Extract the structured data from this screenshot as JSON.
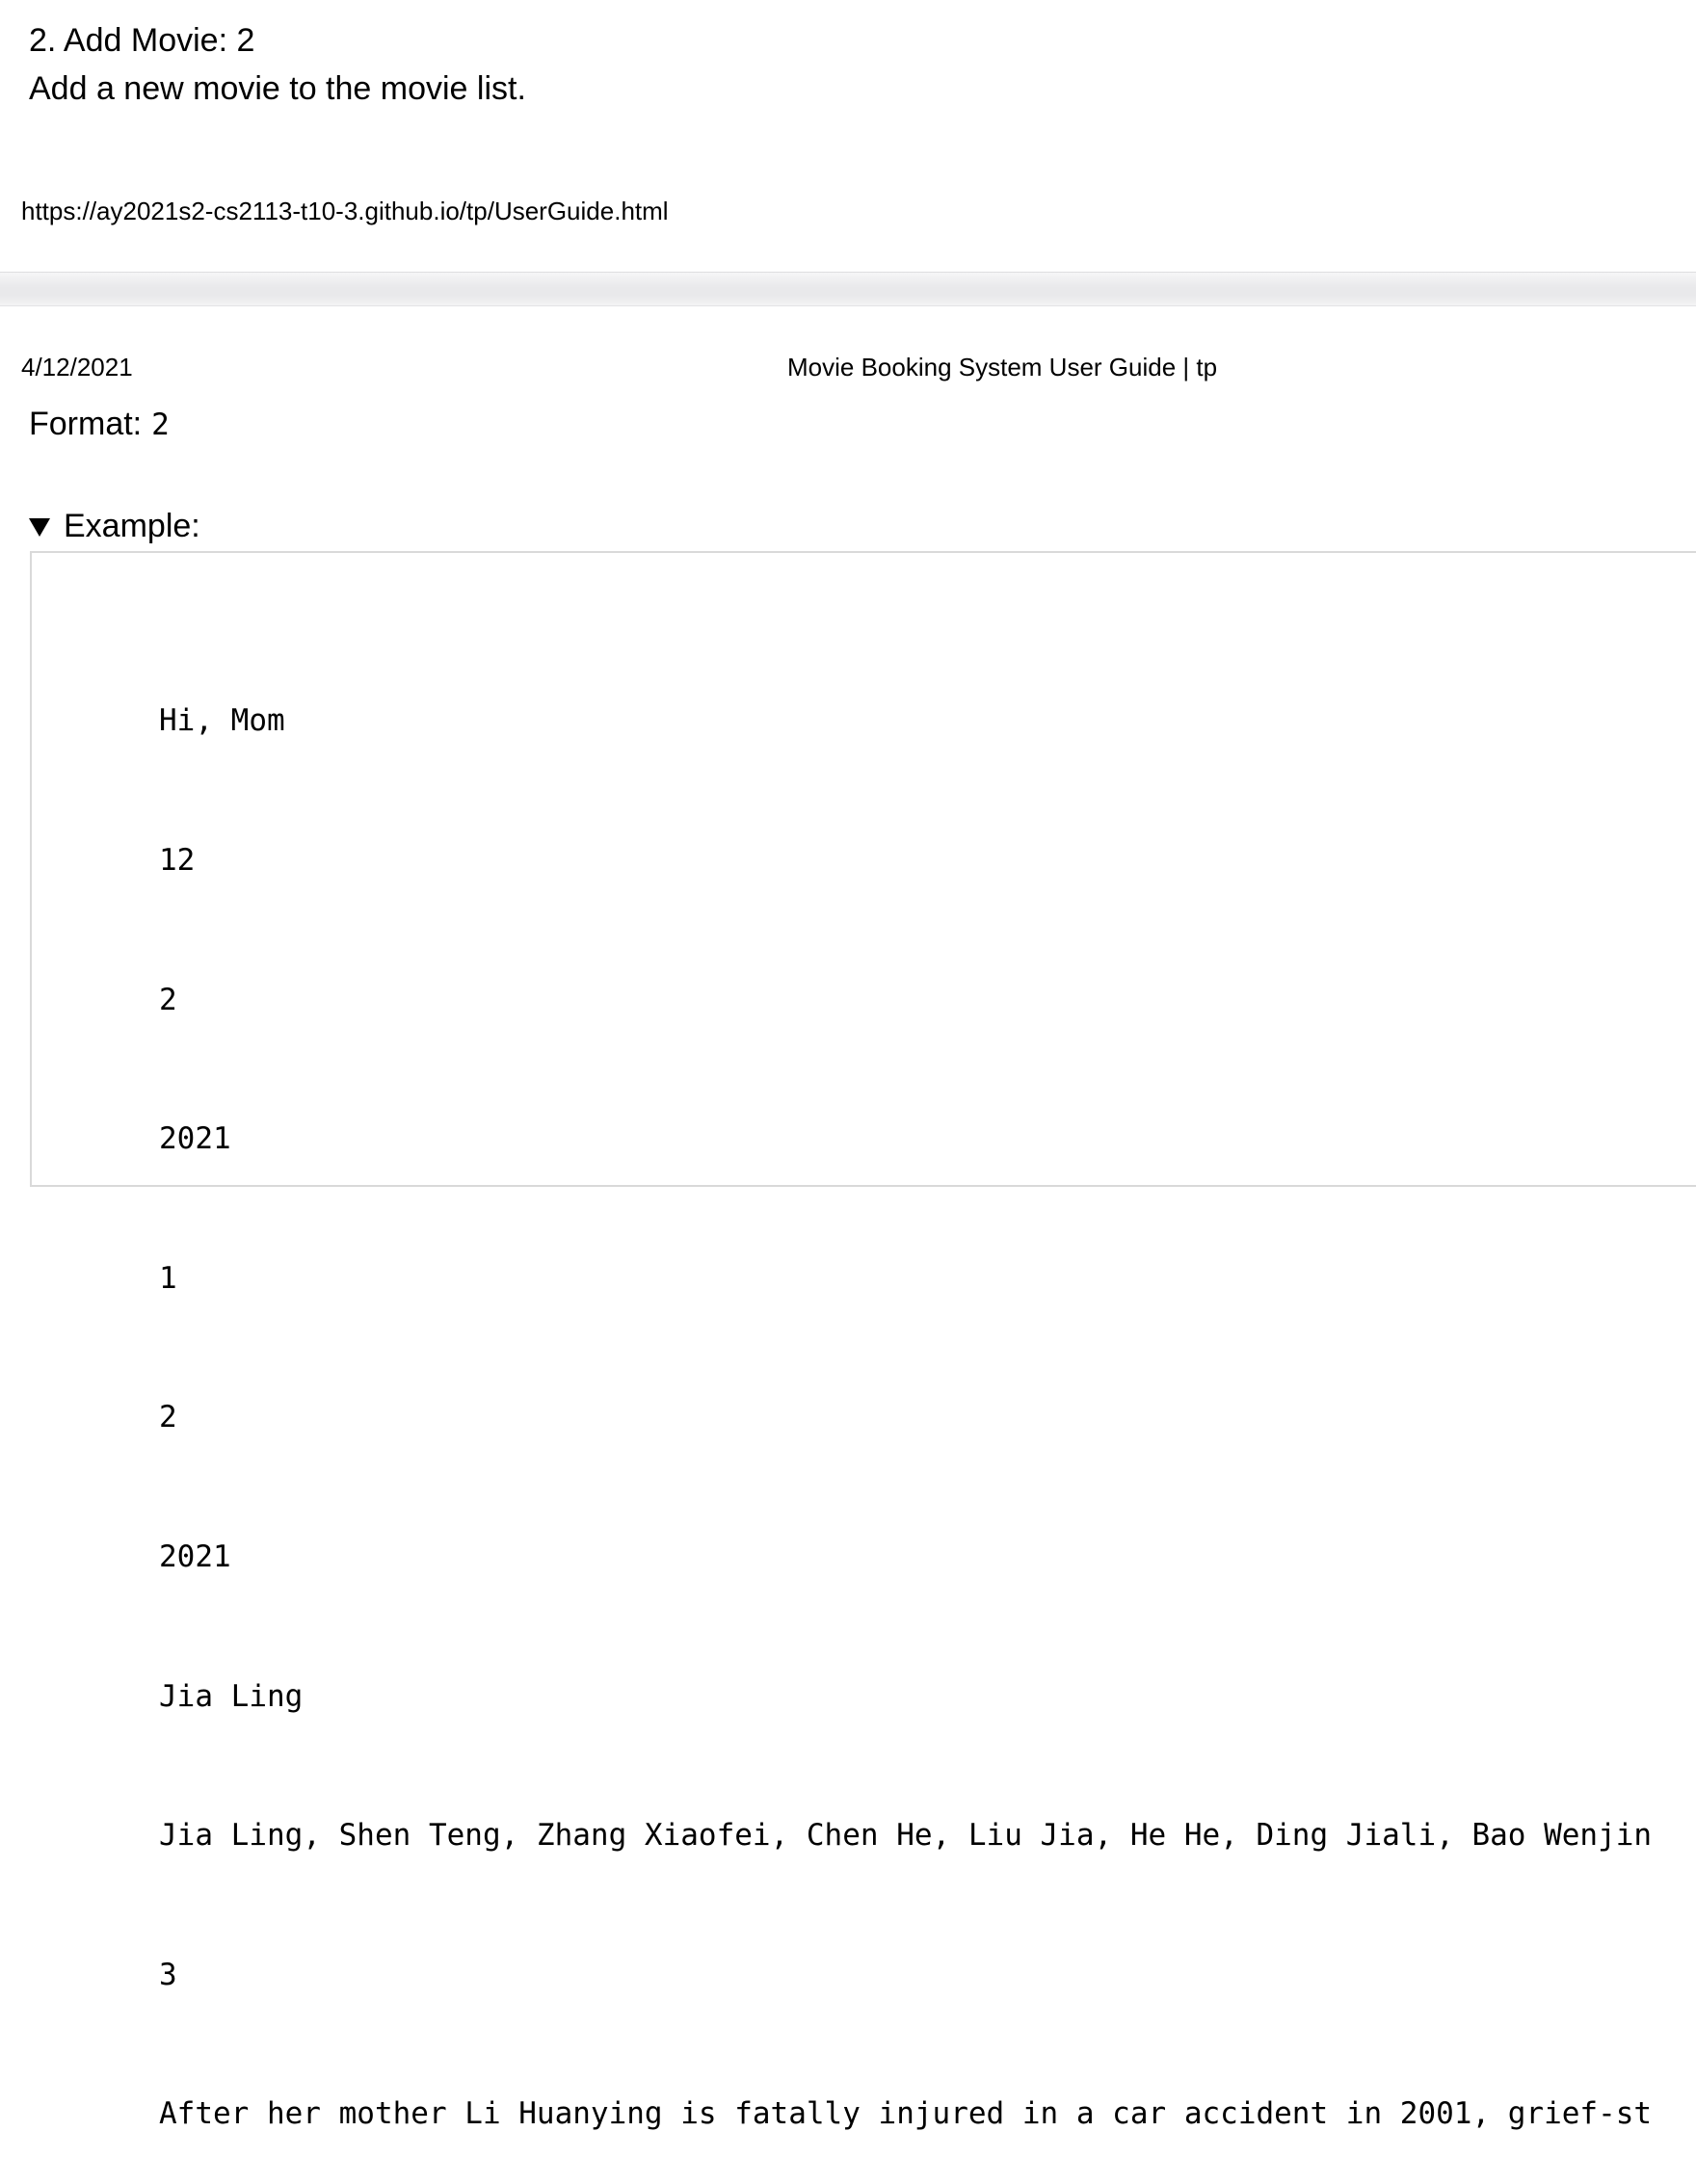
{
  "header": {
    "heading": "2. Add Movie: 2",
    "description": "Add a new movie to the movie list.",
    "url": "https://ay2021s2-cs2113-t10-3.github.io/tp/UserGuide.html"
  },
  "print_header": {
    "date": "4/12/2021",
    "title": "Movie Booking System User Guide | tp"
  },
  "format": {
    "label": "Format:",
    "code": "2"
  },
  "example": {
    "summary": "Example:",
    "lines": [
      "Hi, Mom",
      "12",
      "2",
      "2021",
      "1",
      "2",
      "2021",
      "Jia Ling",
      "Jia Ling, Shen Teng, Zhang Xiaofei, Chen He, Liu Jia, He He, Ding Jiali, Bao Wenjin",
      "3",
      "After her mother Li Huanying is fatally injured in a car accident in 2001, grief-st"
    ]
  }
}
